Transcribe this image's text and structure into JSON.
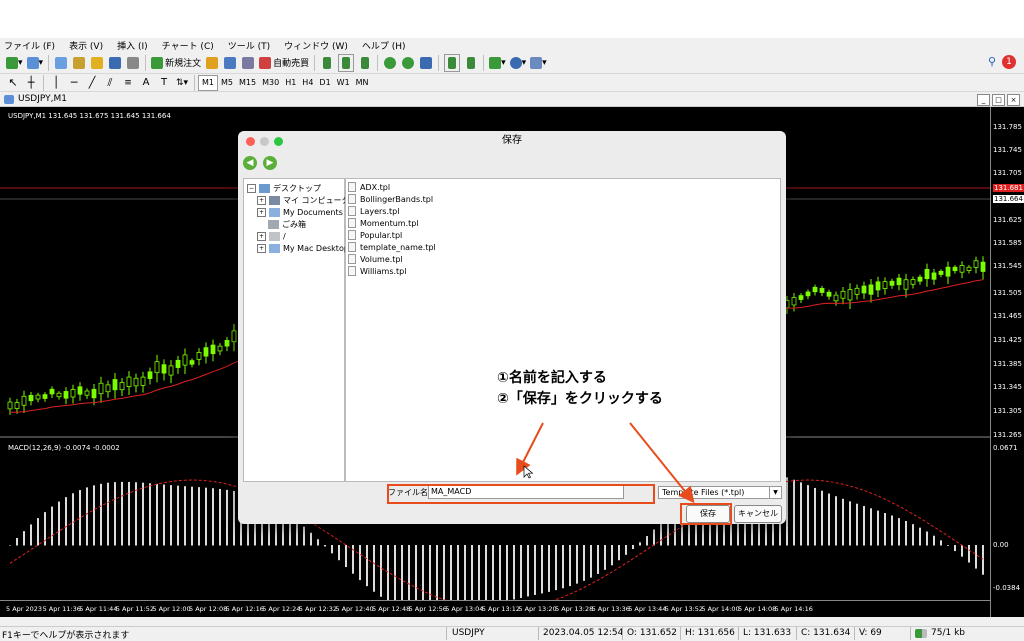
{
  "menu": [
    "ファイル (F)",
    "表示 (V)",
    "挿入 (I)",
    "チャート (C)",
    "ツール (T)",
    "ウィンドウ (W)",
    "ヘルプ (H)"
  ],
  "toolbar": {
    "new_order": "新規注文",
    "auto_trade": "自動売買",
    "badge": "1"
  },
  "timeframes": [
    "M1",
    "M5",
    "M15",
    "M30",
    "H1",
    "H4",
    "D1",
    "W1",
    "MN"
  ],
  "chart_window": {
    "title": "USDJPY,M1",
    "symbol_label": "USDJPY,M1 131.645 131.675 131.645 131.664",
    "macd_label": "MACD(12,26,9) -0.0074 -0.0002"
  },
  "price_axis": [
    "131.785",
    "131.745",
    "131.705",
    "131.665",
    "131.625",
    "131.585",
    "131.545",
    "131.505",
    "131.465",
    "131.425",
    "131.385",
    "131.345",
    "131.305",
    "131.265"
  ],
  "price_highlight": {
    "red": "131.681",
    "white": "131.664"
  },
  "macd_axis": [
    "0.0671",
    "0.00",
    "-0.0384"
  ],
  "time_axis": [
    "5 Apr 2023",
    "5 Apr 11:36",
    "5 Apr 11:44",
    "5 Apr 11:52",
    "5 Apr 12:00",
    "5 Apr 12:08",
    "5 Apr 12:16",
    "5 Apr 12:24",
    "5 Apr 12:32",
    "5 Apr 12:40",
    "5 Apr 12:48",
    "5 Apr 12:56",
    "5 Apr 13:04",
    "5 Apr 13:12",
    "5 Apr 13:20",
    "5 Apr 13:28",
    "5 Apr 13:36",
    "5 Apr 13:44",
    "5 Apr 13:52",
    "5 Apr 14:00",
    "5 Apr 14:08",
    "5 Apr 14:16"
  ],
  "dialog": {
    "title": "保存",
    "tree": [
      "デスクトップ",
      "マイ コンピューター",
      "My Documents",
      "ごみ箱",
      "/",
      "My Mac Desktop"
    ],
    "files": [
      "ADX.tpl",
      "BollingerBands.tpl",
      "Layers.tpl",
      "Momentum.tpl",
      "Popular.tpl",
      "template_name.tpl",
      "Volume.tpl",
      "Williams.tpl"
    ],
    "filename_label": "ファイル名:",
    "filename_value": "MA_MACD",
    "filetype": "Template Files (*.tpl)",
    "save_button": "保存",
    "cancel_button": "キャンセル"
  },
  "annotation": {
    "line1": "①名前を記入する",
    "line2": "②「保存」をクリックする"
  },
  "status": {
    "help": "F1キーでヘルプが表示されます",
    "symbol": "USDJPY",
    "datetime": "2023.04.05 12:54",
    "open": "O: 131.652",
    "high": "H: 131.656",
    "low": "L: 131.633",
    "close": "C: 131.634",
    "volume": "V: 69",
    "traffic": "75/1 kb"
  },
  "colors": {
    "accent": "#e84c1c",
    "candle": "#7cfc00",
    "ma": "#e02020"
  }
}
